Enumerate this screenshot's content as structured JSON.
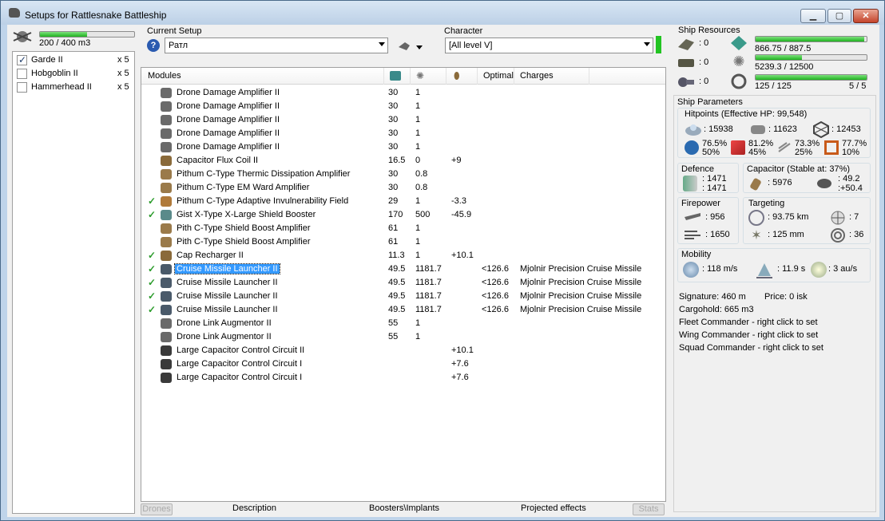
{
  "window": {
    "title": "Setups for Rattlesnake Battleship"
  },
  "drones": {
    "bandwidth": "200 / 400 m3",
    "bandwidth_fraction": 0.5,
    "items": [
      {
        "name": "Garde II",
        "count": "x 5",
        "checked": true
      },
      {
        "name": "Hobgoblin II",
        "count": "x 5",
        "checked": false
      },
      {
        "name": "Hammerhead II",
        "count": "x 5",
        "checked": false
      }
    ]
  },
  "setup": {
    "label": "Current Setup",
    "value": "Ратл"
  },
  "character": {
    "label": "Character",
    "value": "[All level V]"
  },
  "modules": {
    "headers": {
      "name": "Modules",
      "optimal": "Optimal",
      "charges": "Charges"
    },
    "rows": [
      {
        "check": "",
        "name": "Drone Damage Amplifier II",
        "cpu": "30",
        "pg": "1",
        "cap": "",
        "optimal": "",
        "charge": "",
        "icon": "#6a6a6a"
      },
      {
        "check": "",
        "name": "Drone Damage Amplifier II",
        "cpu": "30",
        "pg": "1",
        "cap": "",
        "optimal": "",
        "charge": "",
        "icon": "#6a6a6a"
      },
      {
        "check": "",
        "name": "Drone Damage Amplifier II",
        "cpu": "30",
        "pg": "1",
        "cap": "",
        "optimal": "",
        "charge": "",
        "icon": "#6a6a6a"
      },
      {
        "check": "",
        "name": "Drone Damage Amplifier II",
        "cpu": "30",
        "pg": "1",
        "cap": "",
        "optimal": "",
        "charge": "",
        "icon": "#6a6a6a"
      },
      {
        "check": "",
        "name": "Drone Damage Amplifier II",
        "cpu": "30",
        "pg": "1",
        "cap": "",
        "optimal": "",
        "charge": "",
        "icon": "#6a6a6a"
      },
      {
        "check": "",
        "name": "Capacitor Flux Coil II",
        "cpu": "16.5",
        "pg": "0",
        "cap": "+9",
        "optimal": "",
        "charge": "",
        "icon": "#8a6a3a"
      },
      {
        "check": "",
        "name": "Pithum C-Type Thermic Dissipation Amplifier",
        "cpu": "30",
        "pg": "0.8",
        "cap": "",
        "optimal": "",
        "charge": "",
        "icon": "#9a7a4a"
      },
      {
        "check": "",
        "name": "Pithum C-Type EM Ward Amplifier",
        "cpu": "30",
        "pg": "0.8",
        "cap": "",
        "optimal": "",
        "charge": "",
        "icon": "#9a7a4a"
      },
      {
        "check": "✓",
        "name": "Pithum C-Type Adaptive Invulnerability Field",
        "cpu": "29",
        "pg": "1",
        "cap": "-3.3",
        "optimal": "",
        "charge": "",
        "icon": "#b07a3a"
      },
      {
        "check": "✓",
        "name": "Gist X-Type X-Large Shield Booster",
        "cpu": "170",
        "pg": "500",
        "cap": "-45.9",
        "optimal": "",
        "charge": "",
        "icon": "#5a8a8a"
      },
      {
        "check": "",
        "name": "Pith C-Type Shield Boost Amplifier",
        "cpu": "61",
        "pg": "1",
        "cap": "",
        "optimal": "",
        "charge": "",
        "icon": "#9a7a4a"
      },
      {
        "check": "",
        "name": "Pith C-Type Shield Boost Amplifier",
        "cpu": "61",
        "pg": "1",
        "cap": "",
        "optimal": "",
        "charge": "",
        "icon": "#9a7a4a"
      },
      {
        "check": "✓",
        "name": "Cap Recharger II",
        "cpu": "11.3",
        "pg": "1",
        "cap": "+10.1",
        "optimal": "",
        "charge": "",
        "icon": "#8a6a3a"
      },
      {
        "check": "✓",
        "name": "Cruise Missile Launcher II",
        "cpu": "49.5",
        "pg": "1181.7",
        "cap": "",
        "optimal": "<126.6",
        "charge": "Mjolnir Precision Cruise Missile",
        "icon": "#4a5a6a",
        "selected": true
      },
      {
        "check": "✓",
        "name": "Cruise Missile Launcher II",
        "cpu": "49.5",
        "pg": "1181.7",
        "cap": "",
        "optimal": "<126.6",
        "charge": "Mjolnir Precision Cruise Missile",
        "icon": "#4a5a6a"
      },
      {
        "check": "✓",
        "name": "Cruise Missile Launcher II",
        "cpu": "49.5",
        "pg": "1181.7",
        "cap": "",
        "optimal": "<126.6",
        "charge": "Mjolnir Precision Cruise Missile",
        "icon": "#4a5a6a"
      },
      {
        "check": "✓",
        "name": "Cruise Missile Launcher II",
        "cpu": "49.5",
        "pg": "1181.7",
        "cap": "",
        "optimal": "<126.6",
        "charge": "Mjolnir Precision Cruise Missile",
        "icon": "#4a5a6a"
      },
      {
        "check": "",
        "name": "Drone Link Augmentor II",
        "cpu": "55",
        "pg": "1",
        "cap": "",
        "optimal": "",
        "charge": "",
        "icon": "#6a6a6a"
      },
      {
        "check": "",
        "name": "Drone Link Augmentor II",
        "cpu": "55",
        "pg": "1",
        "cap": "",
        "optimal": "",
        "charge": "",
        "icon": "#6a6a6a"
      },
      {
        "check": "",
        "name": "Large Capacitor Control Circuit II",
        "cpu": "",
        "pg": "",
        "cap": "+10.1",
        "optimal": "",
        "charge": "",
        "icon": "#3a3a3a"
      },
      {
        "check": "",
        "name": "Large Capacitor Control Circuit I",
        "cpu": "",
        "pg": "",
        "cap": "+7.6",
        "optimal": "",
        "charge": "",
        "icon": "#3a3a3a"
      },
      {
        "check": "",
        "name": "Large Capacitor Control Circuit I",
        "cpu": "",
        "pg": "",
        "cap": "+7.6",
        "optimal": "",
        "charge": "",
        "icon": "#3a3a3a"
      }
    ]
  },
  "tabs": {
    "drones": "Drones",
    "description": "Description",
    "boosters": "Boosters\\Implants",
    "projected": "Projected effects",
    "stats": "Stats"
  },
  "resources": {
    "title": "Ship Resources",
    "hi": ": 0",
    "med": ": 0",
    "low": ": 0",
    "cpu": "866.75 / 887.5",
    "cpu_fraction": 0.977,
    "pg": "5239.3 / 12500",
    "pg_fraction": 0.419,
    "calib": "125 / 125",
    "calib_fraction": 1.0,
    "launchers": "5 / 5"
  },
  "params": {
    "title": "Ship Parameters",
    "hitpoints": "Hitpoints (Effective HP: 99,548)",
    "shield_hp": ": 15938",
    "armor_hp": ": 11623",
    "structure_hp": ": 12453",
    "res": [
      {
        "top": "76.5%",
        "bottom": "50%"
      },
      {
        "top": "81.2%",
        "bottom": "45%"
      },
      {
        "top": "73.3%",
        "bottom": "25%"
      },
      {
        "top": "77.7%",
        "bottom": "10%"
      }
    ],
    "defence_label": "Defence",
    "def1": ": 1471",
    "def2": ": 1471",
    "capacitor_label": "Capacitor (Stable at: 37%)",
    "cap_amount": ": 5976",
    "cap1": ": 49.2",
    "cap2": ":+50.4",
    "firepower_label": "Firepower",
    "fp1": ": 956",
    "fp2": ": 1650",
    "targeting_label": "Targeting",
    "range": ": 93.75 km",
    "targets": ": 7",
    "res_mm": ": 125 mm",
    "scan": ": 36",
    "mobility_label": "Mobility",
    "speed": ": 118 m/s",
    "align": ": 11.9 s",
    "warp": ": 3 au/s",
    "signature": "Signature: 460 m",
    "price": "Price: 0 isk",
    "cargo": "Cargohold: 665 m3",
    "fleet": "Fleet Commander - right click to set",
    "wing": "Wing Commander - right click to set",
    "squad": "Squad Commander - right click to set"
  }
}
